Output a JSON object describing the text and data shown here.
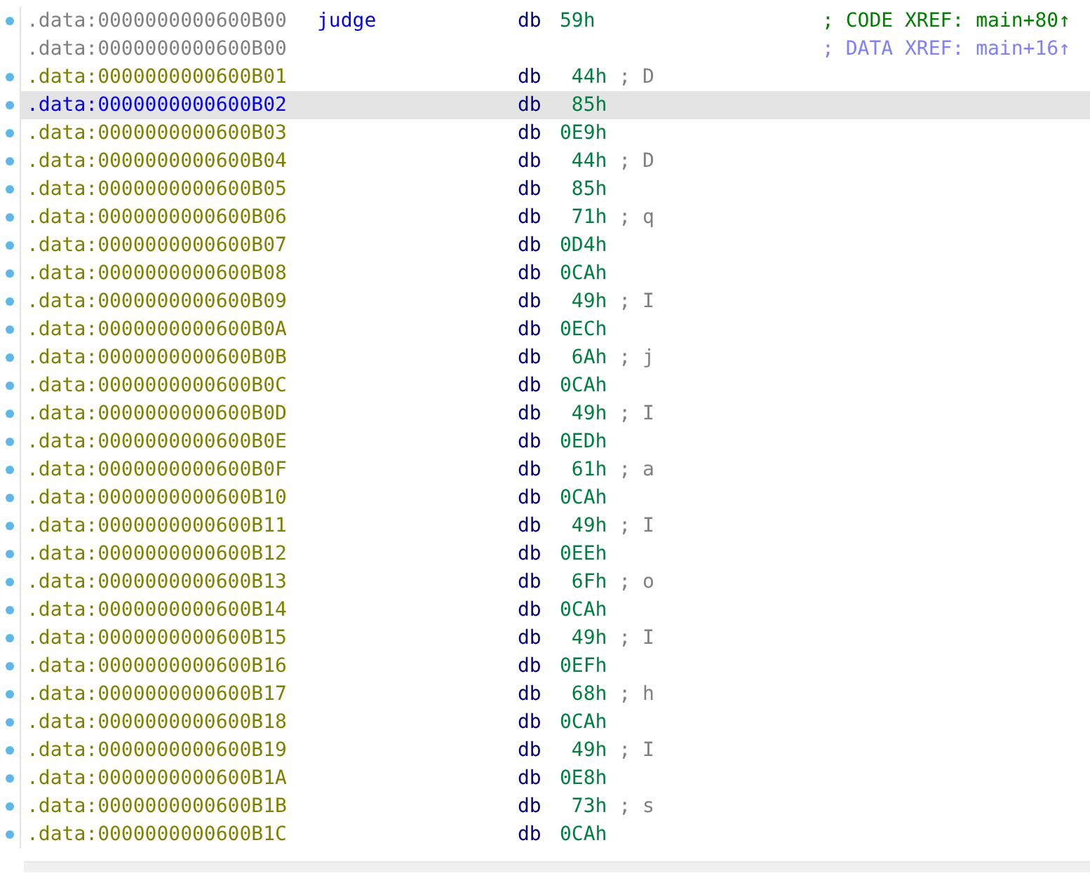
{
  "listing": [
    {
      "kind": "head",
      "marker": true,
      "selected": false,
      "address": ".data:0000000000600B00",
      "label": "judge",
      "op": "db",
      "value": "59h",
      "comment": "; CODE XREF: main+80↑"
    },
    {
      "kind": "cont",
      "marker": false,
      "selected": false,
      "address": ".data:0000000000600B00",
      "comment": "; DATA XREF: main+16↑"
    },
    {
      "kind": "data",
      "marker": true,
      "selected": false,
      "address": ".data:0000000000600B01",
      "op": "db",
      "value": "44h",
      "comment": "; D"
    },
    {
      "kind": "data",
      "marker": true,
      "selected": true,
      "address": ".data:0000000000600B02",
      "op": "db",
      "value": "85h"
    },
    {
      "kind": "data",
      "marker": true,
      "selected": false,
      "address": ".data:0000000000600B03",
      "op": "db",
      "value": "0E9h"
    },
    {
      "kind": "data",
      "marker": true,
      "selected": false,
      "address": ".data:0000000000600B04",
      "op": "db",
      "value": "44h",
      "comment": "; D"
    },
    {
      "kind": "data",
      "marker": true,
      "selected": false,
      "address": ".data:0000000000600B05",
      "op": "db",
      "value": "85h"
    },
    {
      "kind": "data",
      "marker": true,
      "selected": false,
      "address": ".data:0000000000600B06",
      "op": "db",
      "value": "71h",
      "comment": "; q"
    },
    {
      "kind": "data",
      "marker": true,
      "selected": false,
      "address": ".data:0000000000600B07",
      "op": "db",
      "value": "0D4h"
    },
    {
      "kind": "data",
      "marker": true,
      "selected": false,
      "address": ".data:0000000000600B08",
      "op": "db",
      "value": "0CAh"
    },
    {
      "kind": "data",
      "marker": true,
      "selected": false,
      "address": ".data:0000000000600B09",
      "op": "db",
      "value": "49h",
      "comment": "; I"
    },
    {
      "kind": "data",
      "marker": true,
      "selected": false,
      "address": ".data:0000000000600B0A",
      "op": "db",
      "value": "0ECh"
    },
    {
      "kind": "data",
      "marker": true,
      "selected": false,
      "address": ".data:0000000000600B0B",
      "op": "db",
      "value": "6Ah",
      "comment": "; j"
    },
    {
      "kind": "data",
      "marker": true,
      "selected": false,
      "address": ".data:0000000000600B0C",
      "op": "db",
      "value": "0CAh"
    },
    {
      "kind": "data",
      "marker": true,
      "selected": false,
      "address": ".data:0000000000600B0D",
      "op": "db",
      "value": "49h",
      "comment": "; I"
    },
    {
      "kind": "data",
      "marker": true,
      "selected": false,
      "address": ".data:0000000000600B0E",
      "op": "db",
      "value": "0EDh"
    },
    {
      "kind": "data",
      "marker": true,
      "selected": false,
      "address": ".data:0000000000600B0F",
      "op": "db",
      "value": "61h",
      "comment": "; a"
    },
    {
      "kind": "data",
      "marker": true,
      "selected": false,
      "address": ".data:0000000000600B10",
      "op": "db",
      "value": "0CAh"
    },
    {
      "kind": "data",
      "marker": true,
      "selected": false,
      "address": ".data:0000000000600B11",
      "op": "db",
      "value": "49h",
      "comment": "; I"
    },
    {
      "kind": "data",
      "marker": true,
      "selected": false,
      "address": ".data:0000000000600B12",
      "op": "db",
      "value": "0EEh"
    },
    {
      "kind": "data",
      "marker": true,
      "selected": false,
      "address": ".data:0000000000600B13",
      "op": "db",
      "value": "6Fh",
      "comment": "; o"
    },
    {
      "kind": "data",
      "marker": true,
      "selected": false,
      "address": ".data:0000000000600B14",
      "op": "db",
      "value": "0CAh"
    },
    {
      "kind": "data",
      "marker": true,
      "selected": false,
      "address": ".data:0000000000600B15",
      "op": "db",
      "value": "49h",
      "comment": "; I"
    },
    {
      "kind": "data",
      "marker": true,
      "selected": false,
      "address": ".data:0000000000600B16",
      "op": "db",
      "value": "0EFh"
    },
    {
      "kind": "data",
      "marker": true,
      "selected": false,
      "address": ".data:0000000000600B17",
      "op": "db",
      "value": "68h",
      "comment": "; h"
    },
    {
      "kind": "data",
      "marker": true,
      "selected": false,
      "address": ".data:0000000000600B18",
      "op": "db",
      "value": "0CAh"
    },
    {
      "kind": "data",
      "marker": true,
      "selected": false,
      "address": ".data:0000000000600B19",
      "op": "db",
      "value": "49h",
      "comment": "; I"
    },
    {
      "kind": "data",
      "marker": true,
      "selected": false,
      "address": ".data:0000000000600B1A",
      "op": "db",
      "value": "0E8h"
    },
    {
      "kind": "data",
      "marker": true,
      "selected": false,
      "address": ".data:0000000000600B1B",
      "op": "db",
      "value": "73h",
      "comment": "; s"
    },
    {
      "kind": "data",
      "marker": true,
      "selected": false,
      "address": ".data:0000000000600B1C",
      "op": "db",
      "value": "0CAh"
    }
  ]
}
